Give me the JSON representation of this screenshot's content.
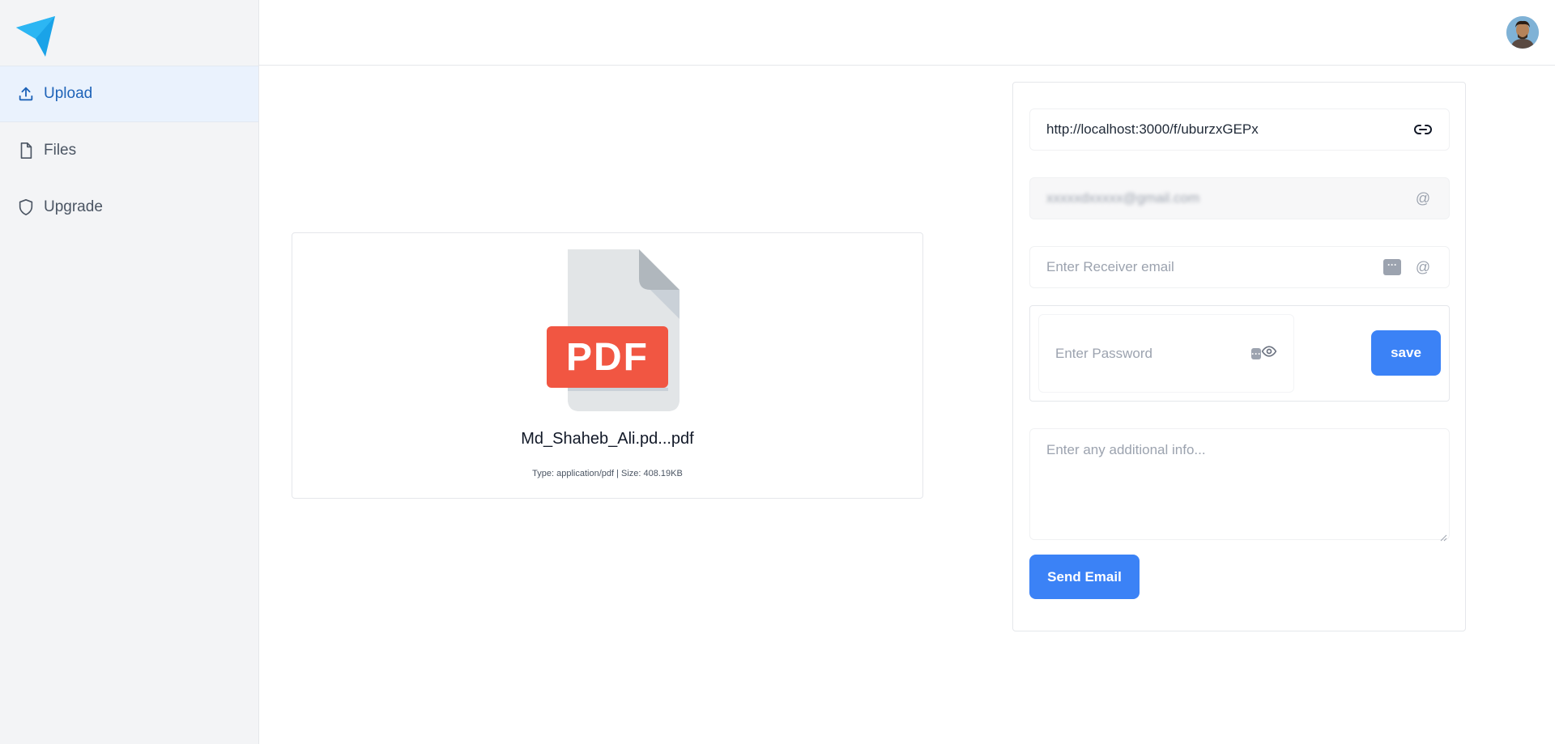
{
  "sidebar": {
    "logo_icon": "paper-plane-logo",
    "items": [
      {
        "label": "Upload",
        "icon": "upload-icon",
        "active": true
      },
      {
        "label": "Files",
        "icon": "file-icon",
        "active": false
      },
      {
        "label": "Upgrade",
        "icon": "shield-icon",
        "active": false
      }
    ]
  },
  "header": {
    "avatar": "user-avatar"
  },
  "file": {
    "badge": "PDF",
    "name": "Md_Shaheb_Ali.pd...pdf",
    "meta": "Type: application/pdf | Size: 408.19KB"
  },
  "form": {
    "share_url": "http://localhost:3000/f/uburzxGEPx",
    "sender_email": "xxxxxdxxxxx@gmail.com",
    "receiver_placeholder": "Enter Receiver email",
    "password_placeholder": "Enter Password",
    "save_label": "save",
    "info_placeholder": "Enter any additional info...",
    "send_label": "Send Email"
  },
  "colors": {
    "accent": "#3b82f6",
    "active_nav": "#1e63b8",
    "pdf_red": "#f15642"
  }
}
